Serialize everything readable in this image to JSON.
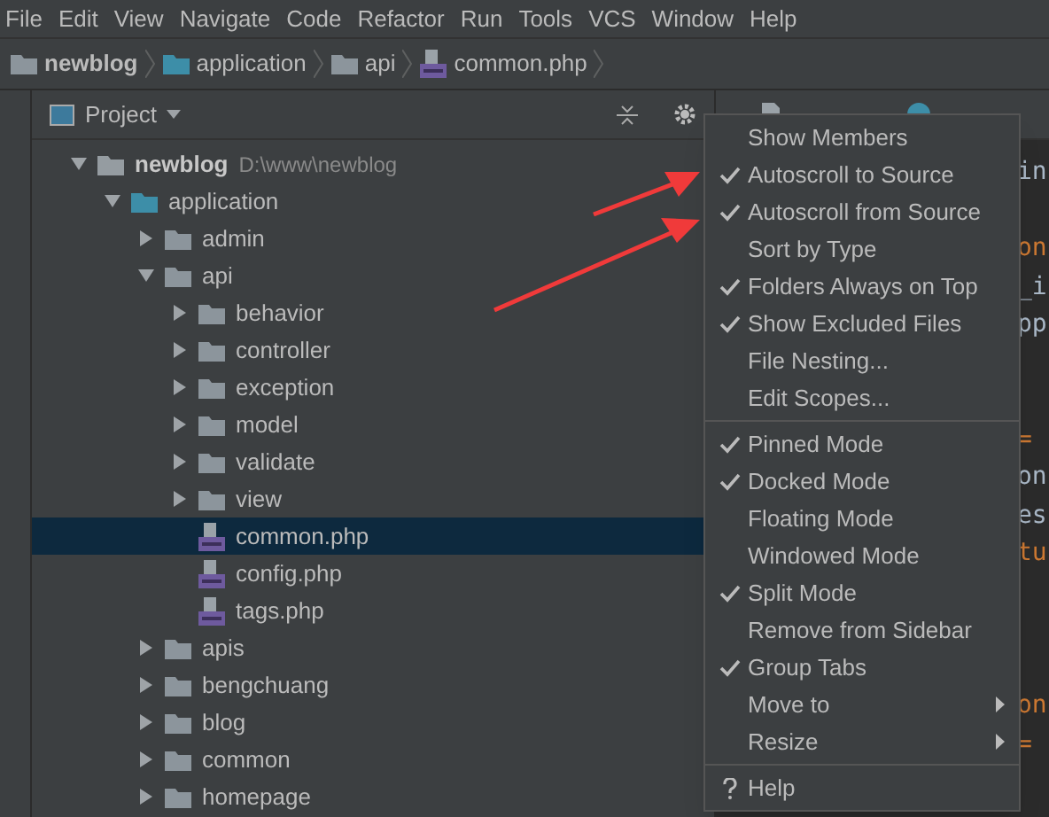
{
  "menu_bar": [
    "File",
    "Edit",
    "View",
    "Navigate",
    "Code",
    "Refactor",
    "Run",
    "Tools",
    "VCS",
    "Window",
    "Help"
  ],
  "breadcrumb": [
    {
      "label": "newblog",
      "kind": "folder"
    },
    {
      "label": "application",
      "kind": "source"
    },
    {
      "label": "api",
      "kind": "folder"
    },
    {
      "label": "common.php",
      "kind": "php"
    }
  ],
  "project_panel": {
    "title": "Project",
    "tree": [
      {
        "label": "newblog",
        "path": "D:\\www\\newblog",
        "kind": "root",
        "expanded": true,
        "selected": false,
        "children": [
          {
            "label": "application",
            "kind": "source",
            "expanded": true,
            "selected": false,
            "children": [
              {
                "label": "admin",
                "kind": "folder",
                "expanded": false,
                "selected": false
              },
              {
                "label": "api",
                "kind": "folder",
                "expanded": true,
                "selected": false,
                "children": [
                  {
                    "label": "behavior",
                    "kind": "folder",
                    "expanded": false,
                    "selected": false
                  },
                  {
                    "label": "controller",
                    "kind": "folder",
                    "expanded": false,
                    "selected": false
                  },
                  {
                    "label": "exception",
                    "kind": "folder",
                    "expanded": false,
                    "selected": false
                  },
                  {
                    "label": "model",
                    "kind": "folder",
                    "expanded": false,
                    "selected": false
                  },
                  {
                    "label": "validate",
                    "kind": "folder",
                    "expanded": false,
                    "selected": false
                  },
                  {
                    "label": "view",
                    "kind": "folder",
                    "expanded": false,
                    "selected": false
                  },
                  {
                    "label": "common.php",
                    "kind": "php",
                    "selected": true
                  },
                  {
                    "label": "config.php",
                    "kind": "php",
                    "selected": false
                  },
                  {
                    "label": "tags.php",
                    "kind": "php",
                    "selected": false
                  }
                ]
              },
              {
                "label": "apis",
                "kind": "folder",
                "expanded": false,
                "selected": false
              },
              {
                "label": "bengchuang",
                "kind": "folder",
                "expanded": false,
                "selected": false
              },
              {
                "label": "blog",
                "kind": "folder",
                "expanded": false,
                "selected": false
              },
              {
                "label": "common",
                "kind": "folder",
                "expanded": false,
                "selected": false
              },
              {
                "label": "homepage",
                "kind": "folder",
                "expanded": false,
                "selected": false
              }
            ]
          }
        ]
      }
    ]
  },
  "editor": {
    "tabs": [
      {
        "kind": "html"
      },
      {
        "kind": "class"
      }
    ],
    "lines": [
      {
        "kind": "code",
        "text": "in",
        "color": "#a9b7c6"
      },
      {
        "kind": "blank"
      },
      {
        "kind": "code",
        "text": "on",
        "color": "#cc7832"
      },
      {
        "kind": "code",
        "text": "_i",
        "color": "#a9b7c6"
      },
      {
        "kind": "code",
        "text": "pp",
        "color": "#a9b7c6"
      },
      {
        "kind": "blank"
      },
      {
        "kind": "blank"
      },
      {
        "kind": "code",
        "text": "=",
        "color": "#cc7832"
      },
      {
        "kind": "code",
        "text": "on",
        "color": "#a9b7c6"
      },
      {
        "kind": "code",
        "text": "es",
        "color": "#a9b7c6"
      },
      {
        "kind": "code",
        "text": "tu",
        "color": "#cc7832"
      },
      {
        "kind": "blank"
      },
      {
        "kind": "blank"
      },
      {
        "kind": "blank"
      },
      {
        "kind": "code",
        "text": "on",
        "color": "#cc7832"
      },
      {
        "kind": "code",
        "text": "=",
        "color": "#cc7832"
      }
    ]
  },
  "context_menu": {
    "items": [
      {
        "kind": "item",
        "label": "Show Members",
        "checked": false
      },
      {
        "kind": "item",
        "label": "Autoscroll to Source",
        "checked": true
      },
      {
        "kind": "item",
        "label": "Autoscroll from Source",
        "checked": true
      },
      {
        "kind": "item",
        "label": "Sort by Type",
        "checked": false
      },
      {
        "kind": "item",
        "label": "Folders Always on Top",
        "checked": true
      },
      {
        "kind": "item",
        "label": "Show Excluded Files",
        "checked": true
      },
      {
        "kind": "item",
        "label": "File Nesting...",
        "checked": false
      },
      {
        "kind": "item",
        "label": "Edit Scopes...",
        "checked": false
      },
      {
        "kind": "separator"
      },
      {
        "kind": "item",
        "label": "Pinned Mode",
        "checked": true
      },
      {
        "kind": "item",
        "label": "Docked Mode",
        "checked": true
      },
      {
        "kind": "item",
        "label": "Floating Mode",
        "checked": false
      },
      {
        "kind": "item",
        "label": "Windowed Mode",
        "checked": false
      },
      {
        "kind": "item",
        "label": "Split Mode",
        "checked": true
      },
      {
        "kind": "item",
        "label": "Remove from Sidebar",
        "checked": false
      },
      {
        "kind": "item",
        "label": "Group Tabs",
        "checked": true
      },
      {
        "kind": "submenu",
        "label": "Move to"
      },
      {
        "kind": "submenu",
        "label": "Resize"
      },
      {
        "kind": "separator"
      },
      {
        "kind": "help",
        "label": "Help"
      }
    ]
  }
}
